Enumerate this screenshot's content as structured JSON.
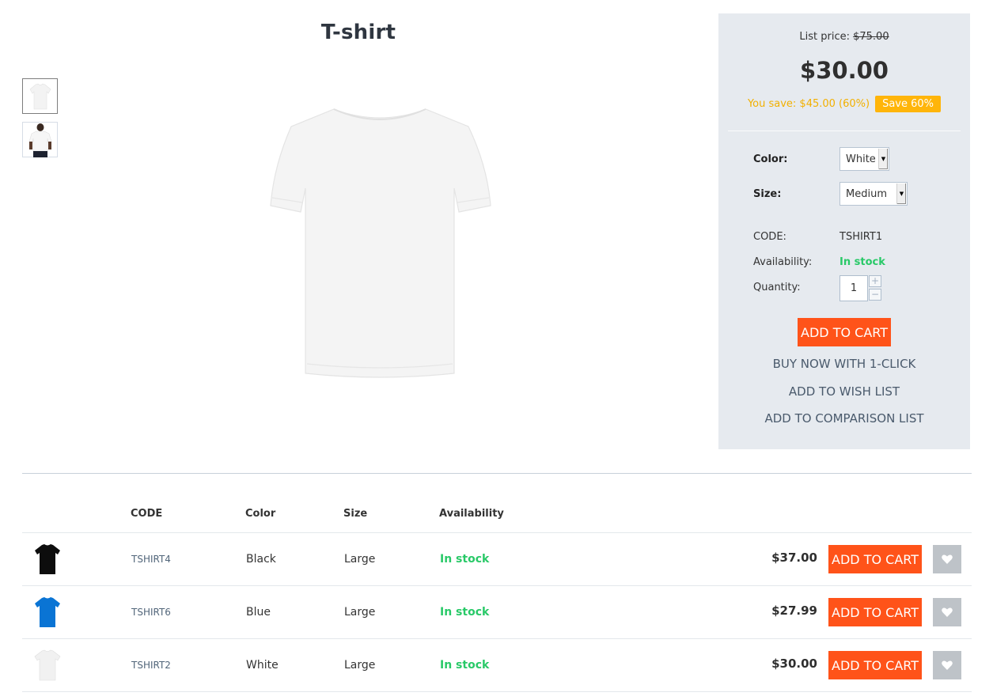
{
  "product": {
    "title": "T-shirt",
    "thumbnails": [
      {
        "alt": "white-tshirt-flat",
        "selected": true
      },
      {
        "alt": "white-tshirt-model",
        "selected": false
      }
    ]
  },
  "pricing": {
    "list_price_label": "List price:",
    "list_price_value": "$75.00",
    "price": "$30.00",
    "you_save": "You save: $45.00 (60%)",
    "save_badge": "Save 60%",
    "accent_color": "#ffb50a"
  },
  "options": {
    "color_label": "Color:",
    "color_value": "White",
    "size_label": "Size:",
    "size_value": "Medium"
  },
  "info": {
    "code_label": "CODE:",
    "code_value": "TSHIRT1",
    "availability_label": "Availability:",
    "availability_value": "In stock",
    "quantity_label": "Quantity:",
    "quantity_value": "1",
    "qty_plus": "+",
    "qty_minus": "−"
  },
  "actions": {
    "add_to_cart": "ADD TO CART",
    "buy_now": "BUY NOW WITH 1-CLICK",
    "wish_list": "ADD TO WISH LIST",
    "comparison": "ADD TO COMPARISON LIST",
    "cart_color": "#ff5319"
  },
  "variants_table": {
    "headers": {
      "code": "CODE",
      "color": "Color",
      "size": "Size",
      "availability": "Availability"
    },
    "rows": [
      {
        "code": "TSHIRT4",
        "color": "Black",
        "size": "Large",
        "availability": "In stock",
        "price": "$37.00",
        "cart": "ADD TO CART",
        "swatch": "#0d0d0d"
      },
      {
        "code": "TSHIRT6",
        "color": "Blue",
        "size": "Large",
        "availability": "In stock",
        "price": "$27.99",
        "cart": "ADD TO CART",
        "swatch": "#0a74d4"
      },
      {
        "code": "TSHIRT2",
        "color": "White",
        "size": "Large",
        "availability": "In stock",
        "price": "$30.00",
        "cart": "ADD TO CART",
        "swatch": "#f1f1f1"
      }
    ]
  }
}
